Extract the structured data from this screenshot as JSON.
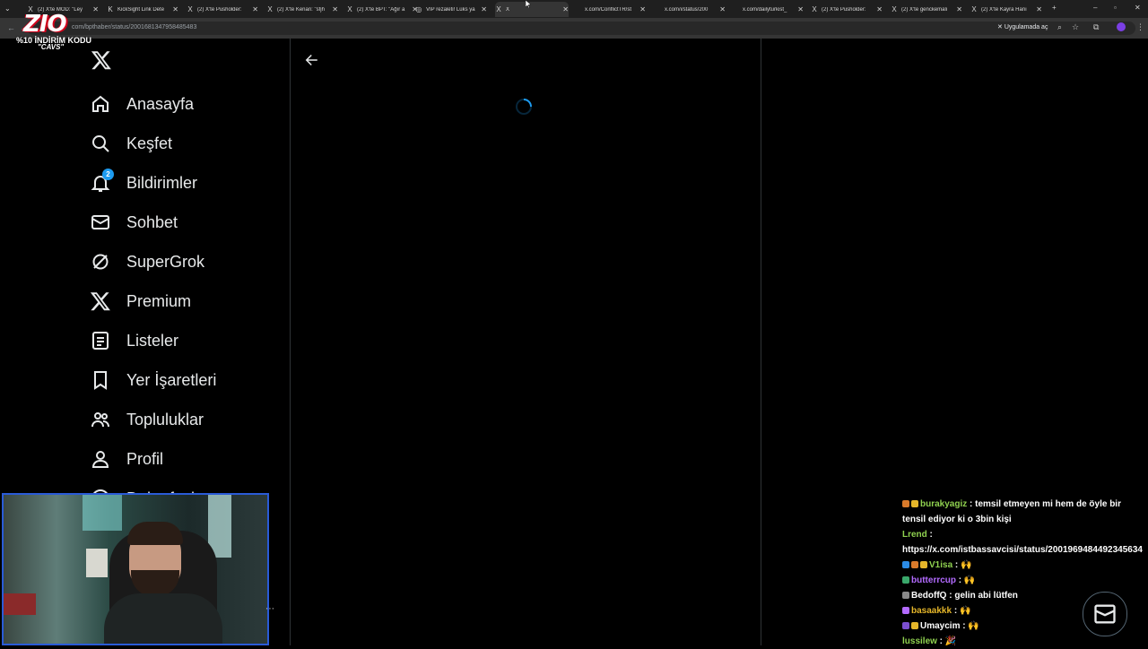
{
  "browser": {
    "tabs": [
      {
        "title": "(2) X'te MOD: \"Ley",
        "icon": "X"
      },
      {
        "title": "KickSight Link Dete",
        "icon": "K"
      },
      {
        "title": "(2) X'te Pusholder: ",
        "icon": "X"
      },
      {
        "title": "(2) X'te Kenan: \"sfjh",
        "icon": "X"
      },
      {
        "title": "(2) X'te BPT: \"Ağır a",
        "icon": "X"
      },
      {
        "title": "VIP rezaleti! Lüks ya",
        "icon": "◎"
      },
      {
        "title": "X",
        "icon": "X",
        "active": true
      },
      {
        "title": "x.com/ConflictTR/st",
        "icon": ""
      },
      {
        "title": "x.com/i/status/200",
        "icon": ""
      },
      {
        "title": "x.com/dailyturkist_",
        "icon": ""
      },
      {
        "title": "(2) X'te Pusholder: ",
        "icon": "X"
      },
      {
        "title": "(2) X'te genckemali",
        "icon": "X"
      },
      {
        "title": "(2) X'te Kayra Hanı",
        "icon": "X"
      }
    ],
    "url": "com/bpthaber/status/2001681347958485483",
    "open_app_label": "Uygulamada aç"
  },
  "overlay": {
    "logo_text": "ZIO",
    "promo_line1": "%10 İNDİRİM KODU",
    "promo_line2": "\"CAVS\""
  },
  "nav": {
    "items": [
      {
        "label": "Anasayfa",
        "icon": "home-icon"
      },
      {
        "label": "Keşfet",
        "icon": "search-icon"
      },
      {
        "label": "Bildirimler",
        "icon": "bell-icon",
        "badge": "2"
      },
      {
        "label": "Sohbet",
        "icon": "mail-icon"
      },
      {
        "label": "SuperGrok",
        "icon": "grok-icon"
      },
      {
        "label": "Premium",
        "icon": "x-logo-icon"
      },
      {
        "label": "Listeler",
        "icon": "list-icon"
      },
      {
        "label": "Yer İşaretleri",
        "icon": "bookmark-icon"
      },
      {
        "label": "Topluluklar",
        "icon": "communities-icon"
      },
      {
        "label": "Profil",
        "icon": "profile-icon"
      },
      {
        "label": "Daha fazla",
        "icon": "more-icon"
      }
    ]
  },
  "chat": {
    "messages": [
      {
        "user": "burakyagiz",
        "color": "#8fd14f",
        "text": "temsil etmeyen mi hem de öyle bir tensil ediyor ki o 3bin kişi",
        "badges": [
          "#d97a2b",
          "#e5b62a"
        ]
      },
      {
        "user": "Lrend",
        "color": "#8fd14f",
        "text": "https://x.com/istbassavcisi/status/2001969484492345634",
        "badges": []
      },
      {
        "user": "V1isa",
        "color": "#8fd14f",
        "text": "🙌",
        "badges": [
          "#2b8be5",
          "#d97a2b",
          "#e5b62a"
        ]
      },
      {
        "user": "butterrcup",
        "color": "#b36bff",
        "text": "🙌",
        "badges": [
          "#3aa86b"
        ]
      },
      {
        "user": "BedoffQ",
        "color": "#ffffff",
        "text": "gelin abi lütfen",
        "badges": [
          "#8a8a8a"
        ]
      },
      {
        "user": "basaakkk",
        "color": "#e5b62a",
        "text": "🙌",
        "badges": [
          "#b36bff"
        ]
      },
      {
        "user": "Umaycim",
        "color": "#ffffff",
        "text": "🙌",
        "badges": [
          "#7b4fd0",
          "#e5b62a"
        ]
      },
      {
        "user": "lussilew",
        "color": "#8fd14f",
        "text": "🎉",
        "badges": []
      }
    ]
  }
}
